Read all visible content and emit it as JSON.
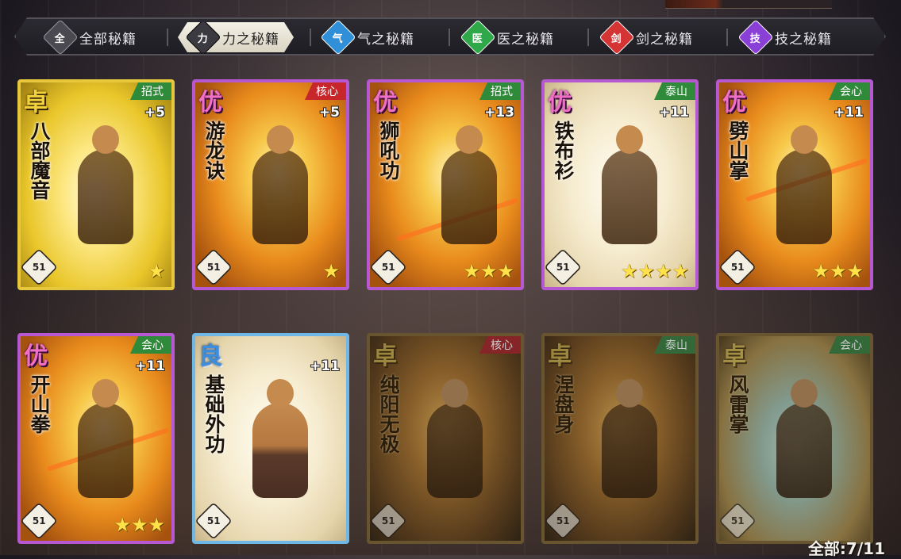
{
  "tabs": [
    {
      "label": "全部秘籍",
      "icon": "all-icon",
      "icon_char": "全",
      "color": "#2b2a31"
    },
    {
      "label": "力之秘籍",
      "icon": "fist-icon",
      "icon_char": "力",
      "color": "#3b3a40"
    },
    {
      "label": "气之秘籍",
      "icon": "swirl-icon",
      "icon_char": "气",
      "color": "#2f8fd8"
    },
    {
      "label": "医之秘籍",
      "icon": "leaf-icon",
      "icon_char": "医",
      "color": "#2fa84a"
    },
    {
      "label": "剑之秘籍",
      "icon": "sword-icon",
      "icon_char": "剑",
      "color": "#d43434"
    },
    {
      "label": "技之秘籍",
      "icon": "skill-icon",
      "icon_char": "技",
      "color": "#8a3fd6"
    }
  ],
  "active_tab": 1,
  "cards": [
    {
      "rank": "卓",
      "tier": "gold",
      "tag": "招式",
      "tag_color": "green",
      "bonus": "+5",
      "name": "八部魔音",
      "level": "51",
      "stars": "★",
      "locked": false
    },
    {
      "rank": "优",
      "tier": "purple",
      "tag": "核心",
      "tag_color": "red",
      "bonus": "+5",
      "name": "游龙诀",
      "level": "51",
      "stars": "★",
      "locked": false
    },
    {
      "rank": "优",
      "tier": "purple",
      "tag": "招式",
      "tag_color": "green",
      "bonus": "+13",
      "name": "狮吼功",
      "level": "51",
      "stars": "★★★",
      "locked": false
    },
    {
      "rank": "优",
      "tier": "purple",
      "tag": "泰山",
      "tag_color": "green",
      "bonus": "+11",
      "name": "铁布衫",
      "level": "51",
      "stars": "★★★★",
      "locked": false
    },
    {
      "rank": "优",
      "tier": "purple",
      "tag": "会心",
      "tag_color": "green",
      "bonus": "+11",
      "name": "劈山掌",
      "level": "51",
      "stars": "★★★",
      "locked": false
    },
    {
      "rank": "优",
      "tier": "purple",
      "tag": "会心",
      "tag_color": "green",
      "bonus": "+11",
      "name": "开山拳",
      "level": "51",
      "stars": "★★★",
      "locked": false
    },
    {
      "rank": "良",
      "tier": "blue",
      "tag": "",
      "tag_color": "",
      "bonus": "+11",
      "name": "基础外功",
      "level": "51",
      "stars": "",
      "locked": false
    },
    {
      "rank": "卓",
      "tier": "locked",
      "tag": "核心",
      "tag_color": "red",
      "bonus": "",
      "name": "纯阳无极",
      "level": "51",
      "stars": "",
      "locked": true
    },
    {
      "rank": "卓",
      "tier": "locked",
      "tag": "泰山",
      "tag_color": "green",
      "bonus": "",
      "name": "涅盘身",
      "level": "51",
      "stars": "",
      "locked": true
    },
    {
      "rank": "卓",
      "tier": "locked",
      "tag": "会心",
      "tag_color": "green",
      "bonus": "",
      "name": "风雷掌",
      "level": "51",
      "stars": "",
      "locked": true
    }
  ],
  "counter": "全部:7/11"
}
